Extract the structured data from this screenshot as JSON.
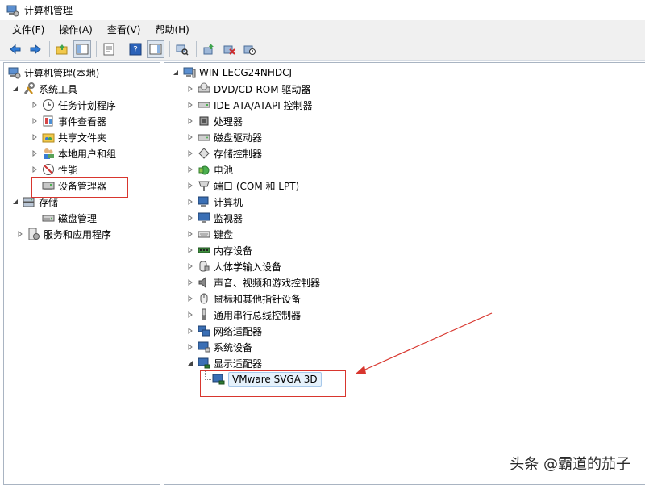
{
  "window": {
    "title": "计算机管理"
  },
  "menu": [
    {
      "label": "文件(F)"
    },
    {
      "label": "操作(A)"
    },
    {
      "label": "查看(V)"
    },
    {
      "label": "帮助(H)"
    }
  ],
  "toolbar": {
    "buttons": [
      "back-arrow-icon",
      "forward-arrow-icon",
      "up-folder-icon",
      "show-hide-tree-icon",
      "properties-icon",
      "help-icon",
      "show-hide-action-pane-icon",
      "scan-hardware-icon",
      "update-driver-icon",
      "uninstall-device-icon",
      "disable-device-icon"
    ]
  },
  "left_tree": {
    "root": "计算机管理(本地)",
    "system_tools": "系统工具",
    "system_tools_children": [
      "任务计划程序",
      "事件查看器",
      "共享文件夹",
      "本地用户和组",
      "性能",
      "设备管理器"
    ],
    "storage": "存储",
    "storage_children": [
      "磁盘管理"
    ],
    "services": "服务和应用程序"
  },
  "device_tree": {
    "root": "WIN-LECG24NHDCJ",
    "categories": [
      "DVD/CD-ROM 驱动器",
      "IDE ATA/ATAPI 控制器",
      "处理器",
      "磁盘驱动器",
      "存储控制器",
      "电池",
      "端口 (COM 和 LPT)",
      "计算机",
      "监视器",
      "键盘",
      "内存设备",
      "人体学输入设备",
      "声音、视频和游戏控制器",
      "鼠标和其他指针设备",
      "通用串行总线控制器",
      "网络适配器",
      "系统设备",
      "显示适配器"
    ],
    "expanded_child": "VMware SVGA 3D"
  },
  "watermark": "头条 @霸道的茄子",
  "colors": {
    "annotation_red": "#d8362e",
    "selection_bg": "#e5f1fb",
    "pane_border": "#a9b4c2"
  }
}
